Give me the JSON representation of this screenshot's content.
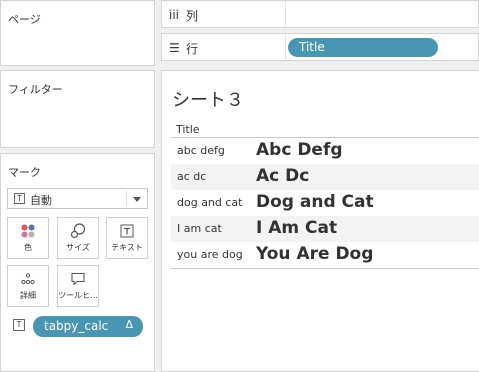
{
  "left_panel": {
    "pages_title": "ページ",
    "filters_title": "フィルター",
    "marks_title": "マーク",
    "marks_type": "自動",
    "mark_buttons": [
      {
        "label": "色",
        "icon": "color-dots-icon"
      },
      {
        "label": "サイズ",
        "icon": "size-shapes-icon"
      },
      {
        "label": "テキスト",
        "icon": "text-t-icon"
      },
      {
        "label": "詳細",
        "icon": "detail-dots-icon"
      },
      {
        "label": "ツールヒ...",
        "icon": "tooltip-bubble-icon"
      }
    ],
    "text_pill": {
      "label": "tabpy_calc",
      "delta": "Δ"
    }
  },
  "shelves": {
    "columns": {
      "label": "列",
      "icon": "iii"
    },
    "rows": {
      "label": "行",
      "icon": "☰",
      "pill": "Title"
    }
  },
  "view": {
    "sheet_title": "シート３",
    "column_header": "Title",
    "rows": [
      {
        "title": "abc defg",
        "calc": "Abc Defg"
      },
      {
        "title": "ac dc",
        "calc": "Ac Dc"
      },
      {
        "title": "dog and cat",
        "calc": "Dog and Cat"
      },
      {
        "title": "I am cat",
        "calc": "I Am Cat"
      },
      {
        "title": "you are dog",
        "calc": "You Are Dog"
      }
    ]
  },
  "colors": {
    "pill_blue": "#4996b2",
    "panel_border": "#d4d4d4",
    "background": "#f0f0f0",
    "dot_red": "#e15759",
    "dot_blue": "#4e79a7",
    "dot_pink": "#d37295",
    "dot_gray": "#bab0ac"
  }
}
